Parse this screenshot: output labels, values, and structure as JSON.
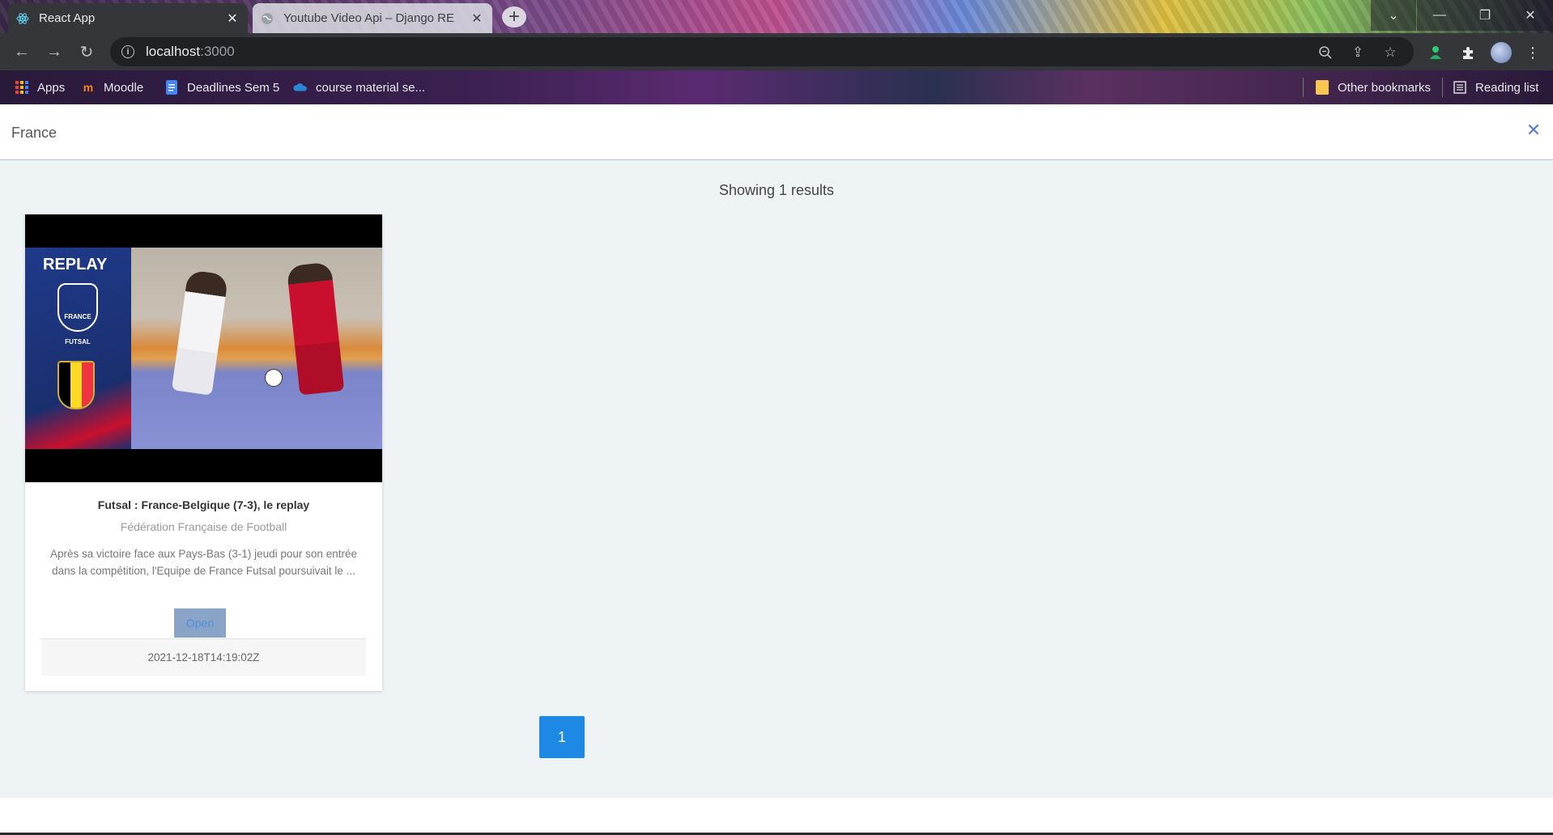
{
  "browser": {
    "tabs": [
      {
        "title": "React App",
        "active": true,
        "favicon": "react-icon"
      },
      {
        "title": "Youtube Video Api – Django RE",
        "active": false,
        "favicon": "globe-icon"
      }
    ],
    "address": {
      "host": "localhost",
      "port": ":3000"
    },
    "bookmarks": [
      {
        "label": "Apps",
        "icon": "apps-grid-icon"
      },
      {
        "label": "Moodle",
        "icon": "moodle-icon"
      },
      {
        "label": "Deadlines Sem 5",
        "icon": "docs-icon"
      },
      {
        "label": "course material se...",
        "icon": "onedrive-icon"
      }
    ],
    "other_bookmarks": "Other bookmarks",
    "reading_list": "Reading list"
  },
  "search": {
    "value": "France"
  },
  "results": {
    "summary": "Showing 1 results"
  },
  "card": {
    "thumbnail_text": "REPLAY",
    "crest_text": "FRANCE",
    "crest_label": "FUTSAL",
    "title": "Futsal : France-Belgique (7-3), le replay",
    "channel": "Fédération Française de Football",
    "description": "Après sa victoire face aux Pays-Bas (3-1) jeudi pour son entrée dans la compétition, l'Equipe de France Futsal poursuivait le ...",
    "open_label": "Open",
    "published": "2021-12-18T14:19:02Z"
  },
  "pagination": {
    "current": "1"
  },
  "colors": {
    "accent": "#1e88e5",
    "open_button": "#8aa4c8"
  }
}
